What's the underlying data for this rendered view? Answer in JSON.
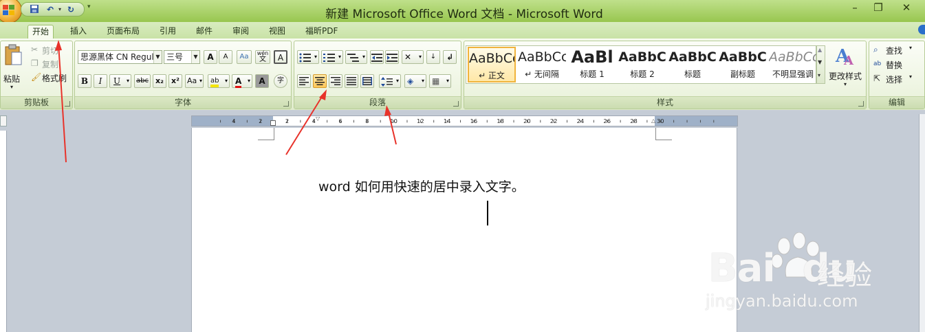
{
  "window": {
    "title": "新建 Microsoft Office Word 文档 - Microsoft Word",
    "controls": {
      "minimize": "–",
      "restore": "❐",
      "close": "✕"
    }
  },
  "quick_access": {
    "save_icon": "save-icon",
    "undo_icon": "undo-icon",
    "redo_icon": "redo-icon"
  },
  "tabs": [
    "开始",
    "插入",
    "页面布局",
    "引用",
    "邮件",
    "审阅",
    "视图",
    "福昕PDF"
  ],
  "active_tab": "开始",
  "clipboard": {
    "paste_label": "粘贴",
    "cut_label": "剪切",
    "copy_label": "复制",
    "format_painter_label": "格式刷",
    "group_label": "剪贴板"
  },
  "font": {
    "font_name": "思源黑体 CN Regul",
    "font_size": "三号",
    "grow": "A",
    "shrink": "A",
    "clear": "Aa",
    "phonetic": "wén",
    "phonetic_char": "文",
    "border_char": "A",
    "bold": "B",
    "italic": "I",
    "underline": "U",
    "strike": "abc",
    "subscript": "x₂",
    "superscript": "x²",
    "change_case": "Aa",
    "highlight": "ab",
    "font_color": "A",
    "shading": "A",
    "enclose": "字",
    "group_label": "字体"
  },
  "paragraph": {
    "group_label": "段落",
    "active_alignment": "center"
  },
  "styles": {
    "group_label": "样式",
    "items": [
      {
        "preview": "AaBbCcDd",
        "name": "↵ 正文"
      },
      {
        "preview": "AaBbCcDd",
        "name": "↵ 无间隔"
      },
      {
        "preview": "AaBl",
        "name": "标题 1"
      },
      {
        "preview": "AaBbC",
        "name": "标题 2"
      },
      {
        "preview": "AaBbC",
        "name": "标题"
      },
      {
        "preview": "AaBbC",
        "name": "副标题"
      },
      {
        "preview": "AaBbCcDd",
        "name": "不明显强调"
      }
    ],
    "change_styles_label": "更改样式"
  },
  "editing": {
    "group_label": "编辑",
    "find_label": "查找",
    "replace_label": "替换",
    "select_label": "选择"
  },
  "ruler": {
    "numbers": [
      "4",
      "2",
      "2",
      "4",
      "6",
      "8",
      "10",
      "12",
      "14",
      "16",
      "18",
      "20",
      "22",
      "24",
      "26",
      "28",
      "30"
    ]
  },
  "document": {
    "text": "word 如何用快速的居中录入文字。"
  },
  "watermark": {
    "brand": "Bai",
    "brand_tail": "du",
    "cn": "经验",
    "url": "jingyan.baidu.com"
  },
  "colors": {
    "title_green": "#9fcc56",
    "annotation_red": "#e8322a",
    "highlight_orange": "#ffc75a"
  }
}
